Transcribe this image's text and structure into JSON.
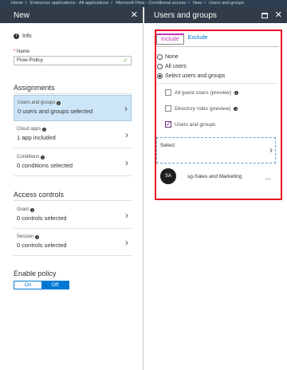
{
  "breadcrumb": [
    "Home",
    "Enterprise applications - All applications",
    "Microsoft Flow - Conditional access",
    "New",
    "Users and groups"
  ],
  "left_blade": {
    "title": "New",
    "info_label": "Info",
    "name_label": "Name",
    "name_value": "Flow Policy",
    "assignments_title": "Assignments",
    "assignments": [
      {
        "label": "Users and groups",
        "value": "0 users and groups selected"
      },
      {
        "label": "Cloud apps",
        "value": "1 app included"
      },
      {
        "label": "Conditions",
        "value": "0 conditions selected"
      }
    ],
    "access_controls_title": "Access controls",
    "access_controls": [
      {
        "label": "Grant",
        "value": "0 controls selected"
      },
      {
        "label": "Session",
        "value": "0 controls selected"
      }
    ],
    "enable_policy_title": "Enable policy",
    "toggle_on": "On",
    "toggle_off": "Off",
    "toggle_selected": "Off"
  },
  "right_blade": {
    "title": "Users and groups",
    "tabs": [
      "Include",
      "Exclude"
    ],
    "active_tab": "Include",
    "radios": [
      "None",
      "All users",
      "Select users and groups"
    ],
    "selected_radio": "Select users and groups",
    "checkboxes": [
      {
        "label": "All guest users (preview)",
        "checked": false
      },
      {
        "label": "Directory roles (preview)",
        "checked": false
      },
      {
        "label": "Users and groups",
        "checked": true
      }
    ],
    "select_label": "Select",
    "member": {
      "initials": "SA",
      "name": "sg-Sales and Marketing",
      "more": "..."
    }
  },
  "colors": {
    "header_bg": "#323c48",
    "breadcrumb_bg": "#2d3e50",
    "accent": "#0078d4",
    "highlight": "#e81123",
    "tab_accent": "#c239b3",
    "selected_item_bg": "#cde6f7"
  },
  "icons": {
    "close": "close-icon",
    "maximize": "maximize-icon",
    "info": "info-icon",
    "chevron": "chevron-right-icon",
    "check": "checkmark-icon",
    "more": "more-icon"
  }
}
